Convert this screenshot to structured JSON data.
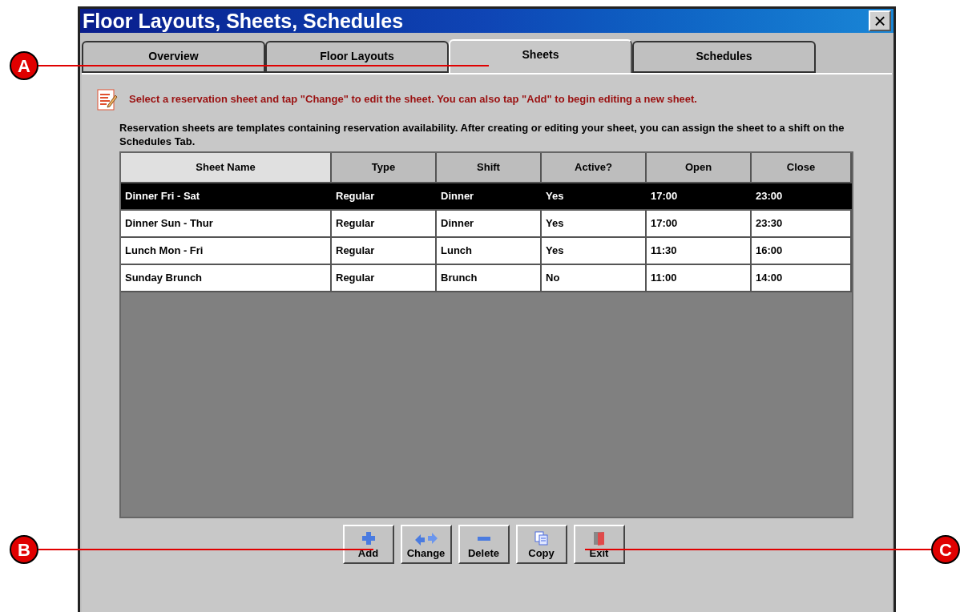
{
  "window": {
    "title": "Floor Layouts, Sheets, Schedules",
    "close": "×"
  },
  "tabs": [
    {
      "label": "Overview",
      "selected": false
    },
    {
      "label": "Floor Layouts",
      "selected": false
    },
    {
      "label": "Sheets",
      "selected": true
    },
    {
      "label": "Schedules",
      "selected": false
    }
  ],
  "instruction": "Select a reservation sheet and tap \"Change\" to edit the sheet.  You can also tap \"Add\" to begin editing a new sheet.",
  "description": "Reservation sheets are templates containing reservation availability. After creating or editing your sheet, you can assign the sheet to a shift on the Schedules Tab.",
  "table": {
    "columns": [
      {
        "label": "Sheet Name",
        "selected": true
      },
      {
        "label": "Type",
        "selected": false
      },
      {
        "label": "Shift",
        "selected": false
      },
      {
        "label": "Active?",
        "selected": false
      },
      {
        "label": "Open",
        "selected": false
      },
      {
        "label": "Close",
        "selected": false
      }
    ],
    "rows": [
      {
        "cells": [
          "Dinner Fri - Sat",
          "Regular",
          "Dinner",
          "Yes",
          "17:00",
          "23:00"
        ],
        "selected": true
      },
      {
        "cells": [
          "Dinner Sun - Thur",
          "Regular",
          "Dinner",
          "Yes",
          "17:00",
          "23:30"
        ],
        "selected": false
      },
      {
        "cells": [
          "Lunch Mon - Fri",
          "Regular",
          "Lunch",
          "Yes",
          "11:30",
          "16:00"
        ],
        "selected": false
      },
      {
        "cells": [
          "Sunday Brunch",
          "Regular",
          "Brunch",
          "No",
          "11:00",
          "14:00"
        ],
        "selected": false
      }
    ]
  },
  "buttons": [
    {
      "label": "Add",
      "kind": "add"
    },
    {
      "label": "Change",
      "kind": "change"
    },
    {
      "label": "Delete",
      "kind": "delete"
    },
    {
      "label": "Copy",
      "kind": "copy"
    },
    {
      "label": "Exit",
      "kind": "exit"
    }
  ],
  "callouts": [
    {
      "label": "A"
    },
    {
      "label": "B"
    },
    {
      "label": "C"
    }
  ]
}
